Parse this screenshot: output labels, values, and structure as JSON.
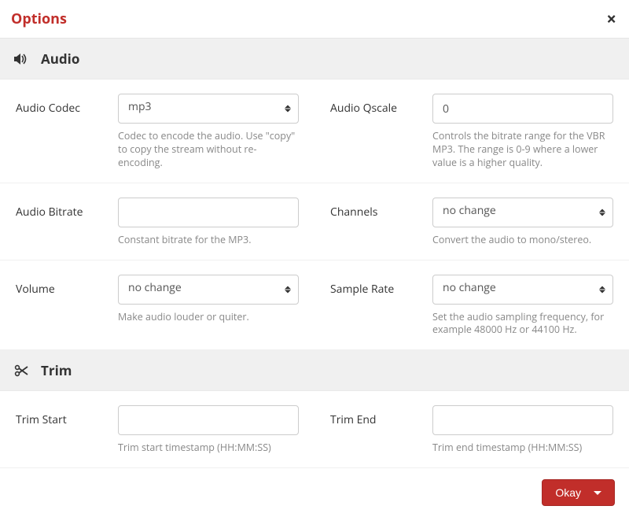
{
  "header": {
    "title": "Options"
  },
  "sections": {
    "audio": {
      "title": "Audio"
    },
    "trim": {
      "title": "Trim"
    }
  },
  "fields": {
    "audioCodec": {
      "label": "Audio Codec",
      "value": "mp3",
      "help": "Codec to encode the audio. Use \"copy\" to copy the stream without re-encoding."
    },
    "audioQscale": {
      "label": "Audio Qscale",
      "value": "0",
      "help": "Controls the bitrate range for the VBR MP3. The range is 0-9 where a lower value is a higher quality."
    },
    "audioBitrate": {
      "label": "Audio Bitrate",
      "value": "",
      "help": "Constant bitrate for the MP3."
    },
    "channels": {
      "label": "Channels",
      "value": "no change",
      "help": "Convert the audio to mono/stereo."
    },
    "volume": {
      "label": "Volume",
      "value": "no change",
      "help": "Make audio louder or quiter."
    },
    "sampleRate": {
      "label": "Sample Rate",
      "value": "no change",
      "help": "Set the audio sampling frequency, for example 48000 Hz or 44100 Hz."
    },
    "trimStart": {
      "label": "Trim Start",
      "value": "",
      "help": "Trim start timestamp (HH:MM:SS)"
    },
    "trimEnd": {
      "label": "Trim End",
      "value": "",
      "help": "Trim end timestamp (HH:MM:SS)"
    }
  },
  "footer": {
    "okay": "Okay"
  },
  "colors": {
    "accent": "#c12e2a"
  }
}
